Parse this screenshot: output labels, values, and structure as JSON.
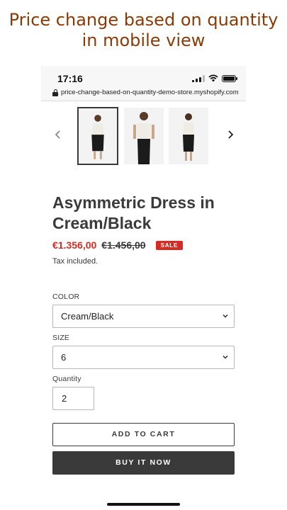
{
  "caption": {
    "line1": "Price change based on quantity",
    "line2": "in mobile view"
  },
  "status_bar": {
    "time": "17:16",
    "url": "price-change-based-on-quantity-demo-store.myshopify.com",
    "icons": [
      "signal-icon",
      "wifi-icon",
      "battery-icon",
      "lock-icon"
    ]
  },
  "gallery": {
    "prev_icon": "chevron-left-icon",
    "next_icon": "chevron-right-icon",
    "thumbnails": [
      "front view",
      "model pose",
      "back view"
    ],
    "active_index": 0
  },
  "product": {
    "title": "Asymmetric Dress in Cream/Black",
    "sale_price": "€1.356,00",
    "compare_price": "€1.456,00",
    "badge": "SALE",
    "tax_note": "Tax included."
  },
  "options": {
    "color_label": "COLOR",
    "color_value": "Cream/Black",
    "size_label": "SIZE",
    "size_value": "6",
    "quantity_label": "Quantity",
    "quantity_value": "2"
  },
  "actions": {
    "add_to_cart": "ADD TO CART",
    "buy_now": "BUY IT NOW"
  },
  "colors": {
    "caption": "#8b3a05",
    "sale": "#d52b25",
    "text": "#3a3a3a",
    "buy_button": "#3a3a3a"
  }
}
